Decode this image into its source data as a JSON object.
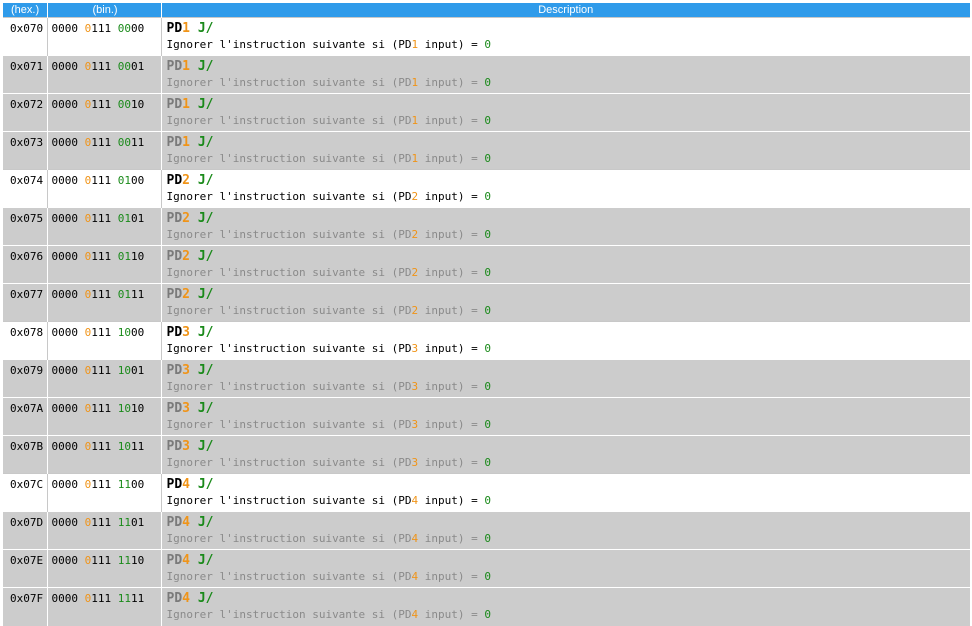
{
  "header": {
    "hex": "(hex.)",
    "bin": "(bin.)",
    "description": "Description"
  },
  "desc_parts": {
    "before": "Ignorer l'instruction suivante si (",
    "after": " input) = ",
    "value": "0"
  },
  "rows": [
    {
      "hex": "0x070",
      "b1": "0000",
      "b2a": "0",
      "b2b": "111",
      "b3": "0000",
      "mn_base": "PD",
      "mn_num": "1",
      "mn_op": "J/",
      "active": true
    },
    {
      "hex": "0x071",
      "b1": "0000",
      "b2a": "0",
      "b2b": "111",
      "b3": "0001",
      "mn_base": "PD",
      "mn_num": "1",
      "mn_op": "J/",
      "active": false
    },
    {
      "hex": "0x072",
      "b1": "0000",
      "b2a": "0",
      "b2b": "111",
      "b3": "0010",
      "mn_base": "PD",
      "mn_num": "1",
      "mn_op": "J/",
      "active": false
    },
    {
      "hex": "0x073",
      "b1": "0000",
      "b2a": "0",
      "b2b": "111",
      "b3": "0011",
      "mn_base": "PD",
      "mn_num": "1",
      "mn_op": "J/",
      "active": false
    },
    {
      "hex": "0x074",
      "b1": "0000",
      "b2a": "0",
      "b2b": "111",
      "b3": "0100",
      "mn_base": "PD",
      "mn_num": "2",
      "mn_op": "J/",
      "active": true
    },
    {
      "hex": "0x075",
      "b1": "0000",
      "b2a": "0",
      "b2b": "111",
      "b3": "0101",
      "mn_base": "PD",
      "mn_num": "2",
      "mn_op": "J/",
      "active": false
    },
    {
      "hex": "0x076",
      "b1": "0000",
      "b2a": "0",
      "b2b": "111",
      "b3": "0110",
      "mn_base": "PD",
      "mn_num": "2",
      "mn_op": "J/",
      "active": false
    },
    {
      "hex": "0x077",
      "b1": "0000",
      "b2a": "0",
      "b2b": "111",
      "b3": "0111",
      "mn_base": "PD",
      "mn_num": "2",
      "mn_op": "J/",
      "active": false
    },
    {
      "hex": "0x078",
      "b1": "0000",
      "b2a": "0",
      "b2b": "111",
      "b3": "1000",
      "mn_base": "PD",
      "mn_num": "3",
      "mn_op": "J/",
      "active": true
    },
    {
      "hex": "0x079",
      "b1": "0000",
      "b2a": "0",
      "b2b": "111",
      "b3": "1001",
      "mn_base": "PD",
      "mn_num": "3",
      "mn_op": "J/",
      "active": false
    },
    {
      "hex": "0x07A",
      "b1": "0000",
      "b2a": "0",
      "b2b": "111",
      "b3": "1010",
      "mn_base": "PD",
      "mn_num": "3",
      "mn_op": "J/",
      "active": false
    },
    {
      "hex": "0x07B",
      "b1": "0000",
      "b2a": "0",
      "b2b": "111",
      "b3": "1011",
      "mn_base": "PD",
      "mn_num": "3",
      "mn_op": "J/",
      "active": false
    },
    {
      "hex": "0x07C",
      "b1": "0000",
      "b2a": "0",
      "b2b": "111",
      "b3": "1100",
      "mn_base": "PD",
      "mn_num": "4",
      "mn_op": "J/",
      "active": true
    },
    {
      "hex": "0x07D",
      "b1": "0000",
      "b2a": "0",
      "b2b": "111",
      "b3": "1101",
      "mn_base": "PD",
      "mn_num": "4",
      "mn_op": "J/",
      "active": false
    },
    {
      "hex": "0x07E",
      "b1": "0000",
      "b2a": "0",
      "b2b": "111",
      "b3": "1110",
      "mn_base": "PD",
      "mn_num": "4",
      "mn_op": "J/",
      "active": false
    },
    {
      "hex": "0x07F",
      "b1": "0000",
      "b2a": "0",
      "b2b": "111",
      "b3": "1111",
      "mn_base": "PD",
      "mn_num": "4",
      "mn_op": "J/",
      "active": false
    }
  ]
}
